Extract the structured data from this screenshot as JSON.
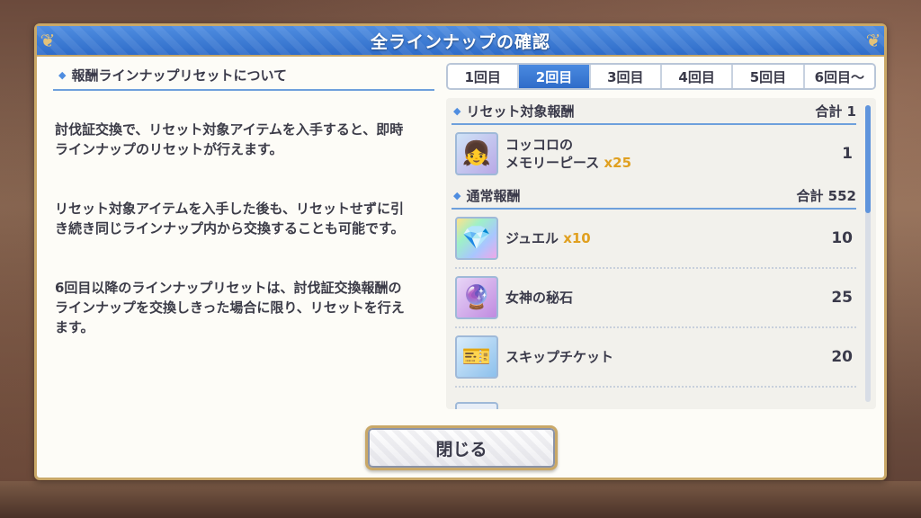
{
  "dialog": {
    "title": "全ラインナップの確認"
  },
  "info": {
    "heading": "報酬ラインナップリセットについて",
    "paragraphs": [
      "討伐証交換で、リセット対象アイテムを入手すると、即時ラインナップのリセットが行えます。",
      "リセット対象アイテムを入手した後も、リセットせずに引き続き同じラインナップ内から交換することも可能です。",
      "6回目以降のラインナップリセットは、討伐証交換報酬のラインナップを交換しきった場合に限り、リセットを行えます。"
    ]
  },
  "tabs": [
    {
      "label": "1回目",
      "active": false
    },
    {
      "label": "2回目",
      "active": true
    },
    {
      "label": "3回目",
      "active": false
    },
    {
      "label": "4回目",
      "active": false
    },
    {
      "label": "5回目",
      "active": false
    },
    {
      "label": "6回目〜",
      "active": false
    }
  ],
  "reset_section": {
    "heading": "リセット対象報酬",
    "total": "合計 1",
    "items": [
      {
        "name_line1": "コッコロの",
        "name_line2": "メモリーピース ",
        "qty": "x25",
        "count": "1",
        "icon": "memory-piece-icon"
      }
    ]
  },
  "normal_section": {
    "heading": "通常報酬",
    "total": "合計 552",
    "items": [
      {
        "name": "ジュエル ",
        "qty": "x10",
        "count": "10",
        "icon": "jewel-icon"
      },
      {
        "name": "女神の秘石",
        "qty": "",
        "count": "25",
        "icon": "goddess-stone-icon"
      },
      {
        "name": "スキップチケット",
        "qty": "",
        "count": "20",
        "icon": "skip-ticket-icon"
      }
    ]
  },
  "scroll": {
    "position": 0.0
  },
  "buttons": {
    "close_label": "閉じる"
  }
}
